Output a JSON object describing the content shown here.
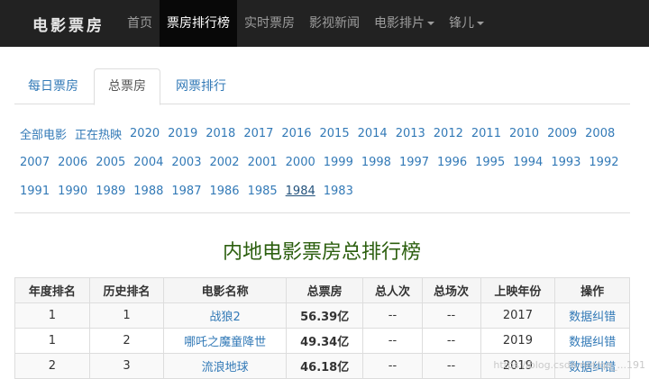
{
  "navbar": {
    "brand": "电影票房",
    "items": [
      {
        "label": "首页",
        "active": false,
        "dropdown": false
      },
      {
        "label": "票房排行榜",
        "active": true,
        "dropdown": false
      },
      {
        "label": "实时票房",
        "active": false,
        "dropdown": false
      },
      {
        "label": "影视新闻",
        "active": false,
        "dropdown": false
      },
      {
        "label": "电影排片",
        "active": false,
        "dropdown": true
      },
      {
        "label": "锋儿",
        "active": false,
        "dropdown": true
      }
    ]
  },
  "tabs": [
    {
      "label": "每日票房",
      "active": false
    },
    {
      "label": "总票房",
      "active": true
    },
    {
      "label": "网票排行",
      "active": false
    }
  ],
  "years": {
    "row1": [
      "全部电影",
      "正在热映",
      "2020",
      "2019",
      "2018",
      "2017",
      "2016",
      "2015",
      "2014",
      "2013",
      "2012",
      "2011",
      "2010",
      "2009",
      "2008"
    ],
    "row2": [
      "2007",
      "2006",
      "2005",
      "2004",
      "2003",
      "2002",
      "2001",
      "2000",
      "1999",
      "1998",
      "1997",
      "1996",
      "1995",
      "1994",
      "1993",
      "1992"
    ],
    "row3": [
      "1991",
      "1990",
      "1989",
      "1988",
      "1987",
      "1986",
      "1985",
      "1984",
      "1983"
    ],
    "current": "1984"
  },
  "page_title": "内地电影票房总排行榜",
  "table": {
    "headers": [
      "年度排名",
      "历史排名",
      "电影名称",
      "总票房",
      "总人次",
      "总场次",
      "上映年份",
      "操作"
    ],
    "rows": [
      [
        "1",
        "1",
        "战狼2",
        "56.39亿",
        "--",
        "--",
        "2017",
        "数据纠错"
      ],
      [
        "1",
        "2",
        "哪吒之魔童降世",
        "49.34亿",
        "--",
        "--",
        "2019",
        "数据纠错"
      ],
      [
        "2",
        "3",
        "流浪地球",
        "46.18亿",
        "--",
        "--",
        "2019",
        "数据纠错"
      ]
    ]
  },
  "watermark": "https://blog.csdn.net/qq_...191"
}
